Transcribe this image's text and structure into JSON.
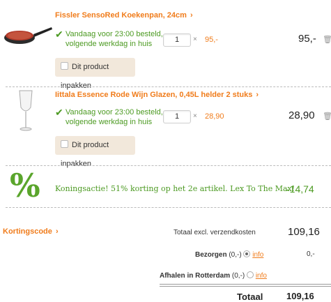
{
  "items": [
    {
      "title": "Fissler SensoRed Koekenpan, 24cm",
      "delivery_line1": "Vandaag voor 23:00 besteld,",
      "delivery_line2": "volgende werkdag in huis",
      "qty": "1",
      "times": "×",
      "unit_price": "95,-",
      "line_total": "95,-",
      "wrap_label": "Dit product inpakken",
      "image_icon": "frying-pan"
    },
    {
      "title": "Iittala Essence Rode Wijn Glazen, 0,45L helder 2 stuks",
      "delivery_line1": "Vandaag voor 23:00 besteld,",
      "delivery_line2": "volgende werkdag in huis",
      "qty": "1",
      "times": "×",
      "unit_price": "28,90",
      "line_total": "28,90",
      "wrap_label": "Dit product inpakken",
      "image_icon": "wine-glass"
    }
  ],
  "promo": {
    "icon": "%",
    "text": "Koningsactie! 51% korting op het 2e artikel. Lex To The Max!",
    "amount": "-14,74"
  },
  "summary": {
    "coupon_link": "Kortingscode",
    "subtotal_label": "Totaal excl. verzendkosten",
    "subtotal_value": "109,16",
    "shipping": [
      {
        "label": "Bezorgen",
        "fee": "(0,-)",
        "info": "info",
        "value": "0,-",
        "selected": true
      },
      {
        "label": "Afhalen in Rotterdam",
        "fee": "(0,-)",
        "info": "info",
        "value": "",
        "selected": false
      }
    ],
    "total_label": "Totaal",
    "total_value": "109,16"
  },
  "colors": {
    "accent": "#f07c1b",
    "success": "#4c9a22",
    "wrap_bg": "#f2e8db"
  }
}
